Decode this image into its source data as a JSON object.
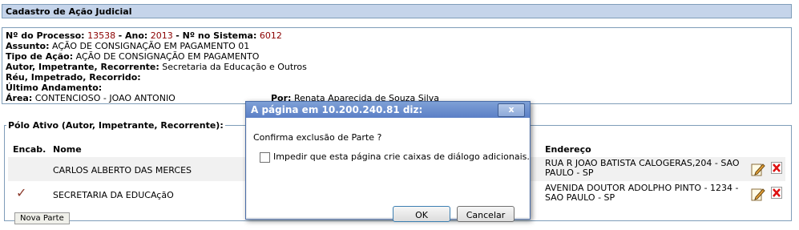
{
  "page_title": "Cadastro de Ação Judicial",
  "process": {
    "num_label": "Nº do Processo:",
    "num_value": "13538",
    "ano_label": "- Ano:",
    "ano_value": "2013",
    "sistema_label": "- Nº no Sistema:",
    "sistema_value": "6012",
    "assunto_label": "Assunto:",
    "assunto_value": "AÇÃO DE CONSIGNAÇÃO EM PAGAMENTO 01",
    "tipo_label": "Tipo de Ação:",
    "tipo_value": "AÇÃO DE CONSIGNAÇÃO EM PAGAMENTO",
    "autor_label": "Autor, Impetrante, Recorrente:",
    "autor_value": "Secretaria da Educação e Outros",
    "reu_label": "Réu, Impetrado, Recorrido:",
    "ultimo_label": "Último Andamento:",
    "area_label": "Área:",
    "area_value": "CONTENCIOSO - JOAO ANTONIO",
    "por_label": "Por:",
    "por_value": "Renata Aparecida de Souza Silva"
  },
  "polo": {
    "legend": "Pólo Ativo (Autor, Impetrante, Recorrente):",
    "headers": {
      "encab": "Encab.",
      "nome": "Nome",
      "endereco": "Endereço"
    },
    "rows": [
      {
        "nome": "CARLOS ALBERTO DAS MERCES",
        "endereco": "RUA R JOAO BATISTA CALOGERAS,204 - SAO PAULO - SP",
        "encab": false
      },
      {
        "nome": "SECRETARIA DA EDUCAçãO",
        "endereco": "AVENIDA DOUTOR ADOLPHO PINTO - 1234 - SAO PAULO - SP",
        "encab": true
      }
    ],
    "nova_parte": "Nova Parte"
  },
  "dialog": {
    "title": "A página em 10.200.240.81 diz:",
    "close": "x",
    "message": "Confirma exclusão de Parte ?",
    "checkbox_label": "Impedir que esta página crie caixas de diálogo adicionais.",
    "ok": "OK",
    "cancel": "Cancelar"
  },
  "icons": {
    "encab": "checkmark-icon",
    "edit": "edit-pencil-icon",
    "delete": "delete-x-icon"
  },
  "colors": {
    "title_bg": "#c5d4ea",
    "value_red": "#8b0000",
    "dialog_title": "#5b7fc6"
  }
}
